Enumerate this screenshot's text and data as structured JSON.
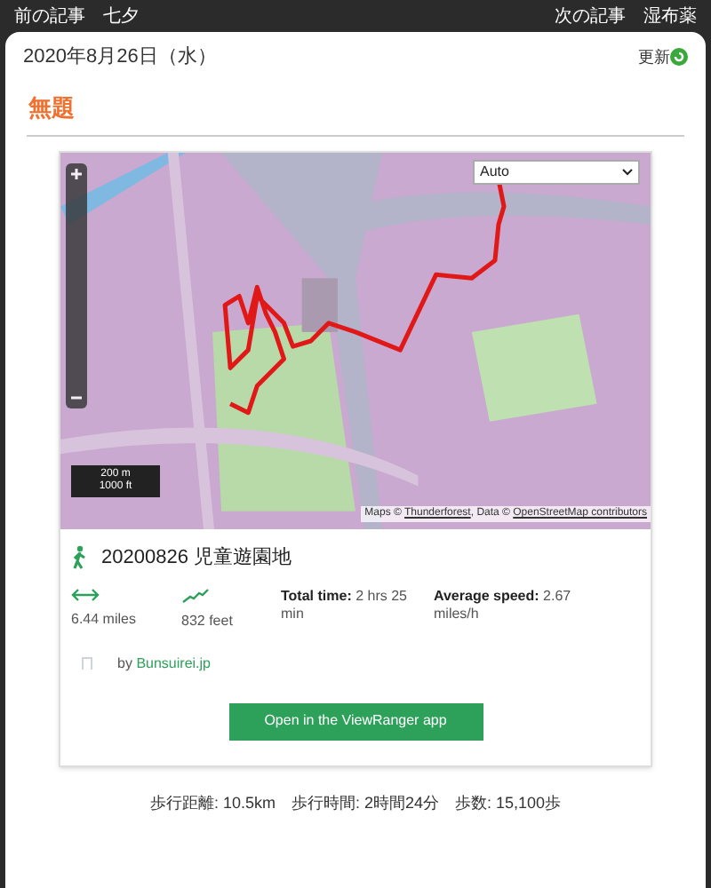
{
  "topbar": {
    "left": [
      "前の記事",
      "七夕"
    ],
    "right": [
      "次の記事",
      "湿布薬"
    ]
  },
  "post": {
    "date": "2020年8月26日（水）",
    "update": "更新",
    "title": "無題"
  },
  "map": {
    "layer_select": "Auto",
    "scale": [
      "200 m",
      "1000 ft"
    ],
    "attribution_prefix": "Maps © ",
    "attribution_link1": "Thunderforest",
    "attribution_mid": ", Data © ",
    "attribution_link2": "OpenStreetMap contributors"
  },
  "route": {
    "name": "20200826 児童遊園地",
    "distance": "6.44 miles",
    "ascent": "832 feet",
    "total_time_label": "Total time:",
    "total_time": "2 hrs 25 min",
    "avg_speed_label": "Average speed:",
    "avg_speed": "2.67 miles/h",
    "by": "by",
    "author": "Bunsuirei.jp",
    "button": "Open in the ViewRanger app"
  },
  "footer": "歩行距離: 10.5km　歩行時間: 2時間24分　歩数: 15,100歩"
}
